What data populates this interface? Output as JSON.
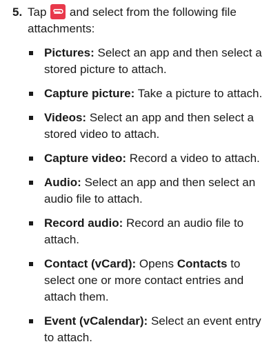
{
  "step": {
    "number": "5.",
    "intro_before_icon": "Tap",
    "intro_icon": "attach-paperclip-icon",
    "intro_after_icon": "and select from the following file attachments:"
  },
  "options": [
    {
      "label": "Pictures:",
      "description": "Select an app and then select a stored picture to attach."
    },
    {
      "label": "Capture picture:",
      "description": "Take a picture to attach."
    },
    {
      "label": "Videos:",
      "description": "Select an app and then select a stored video to attach."
    },
    {
      "label": "Capture video:",
      "description": "Record a video to attach."
    },
    {
      "label": "Audio:",
      "description": "Select an app and then select an audio file to attach."
    },
    {
      "label": "Record audio:",
      "description": "Record an audio file to attach."
    },
    {
      "label": "Contact (vCard):",
      "description_before": "Opens",
      "description_bold": "Contacts",
      "description_after": "to select one or more contact entries and attach them."
    },
    {
      "label": "Event (vCalendar):",
      "description": "Select an event entry to attach."
    }
  ],
  "colors": {
    "icon_background": "#e8394b",
    "text": "#1a1a1a"
  }
}
